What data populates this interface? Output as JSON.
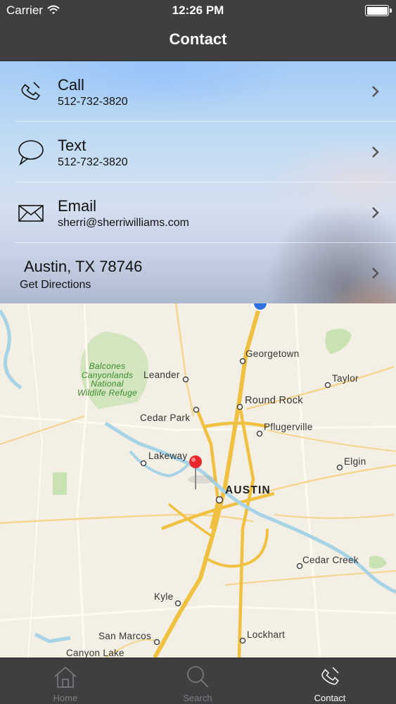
{
  "status_bar": {
    "carrier": "Carrier",
    "time": "12:26 PM",
    "battery_level": 1.0
  },
  "nav": {
    "title": "Contact"
  },
  "contact_rows": [
    {
      "label": "Call",
      "sub": "512-732-3820",
      "icon": "phone-icon"
    },
    {
      "label": "Text",
      "sub": "512-732-3820",
      "icon": "chat-bubble-icon"
    },
    {
      "label": "Email",
      "sub": "sherri@sherriwilliams.com",
      "icon": "envelope-icon"
    },
    {
      "label": "Austin, TX 78746",
      "sub": "Get Directions",
      "icon": ""
    }
  ],
  "map": {
    "labels": {
      "georgetown": "Georgetown",
      "leander": "Leander",
      "taylor": "Taylor",
      "balcones": "Balcones",
      "canyonlands": "Canyonlands",
      "national": "National",
      "refuge": "Wildlife Refuge",
      "cedar_park": "Cedar Park",
      "round_rock": "Round Rock",
      "pflugerville": "Pflugerville",
      "lakeway": "Lakeway",
      "elgin": "Elgin",
      "austin": "AUSTIN",
      "cedar_creek": "Cedar Creek",
      "kyle": "Kyle",
      "san_marcos": "San Marcos",
      "lockhart": "Lockhart",
      "canyon_lake": "Canyon Lake"
    },
    "pin_icon": "map-pin-icon"
  },
  "tabs": [
    {
      "label": "Home",
      "icon": "home-icon",
      "active": false
    },
    {
      "label": "Search",
      "icon": "search-icon",
      "active": false
    },
    {
      "label": "Contact",
      "icon": "phone-icon",
      "active": true
    }
  ]
}
